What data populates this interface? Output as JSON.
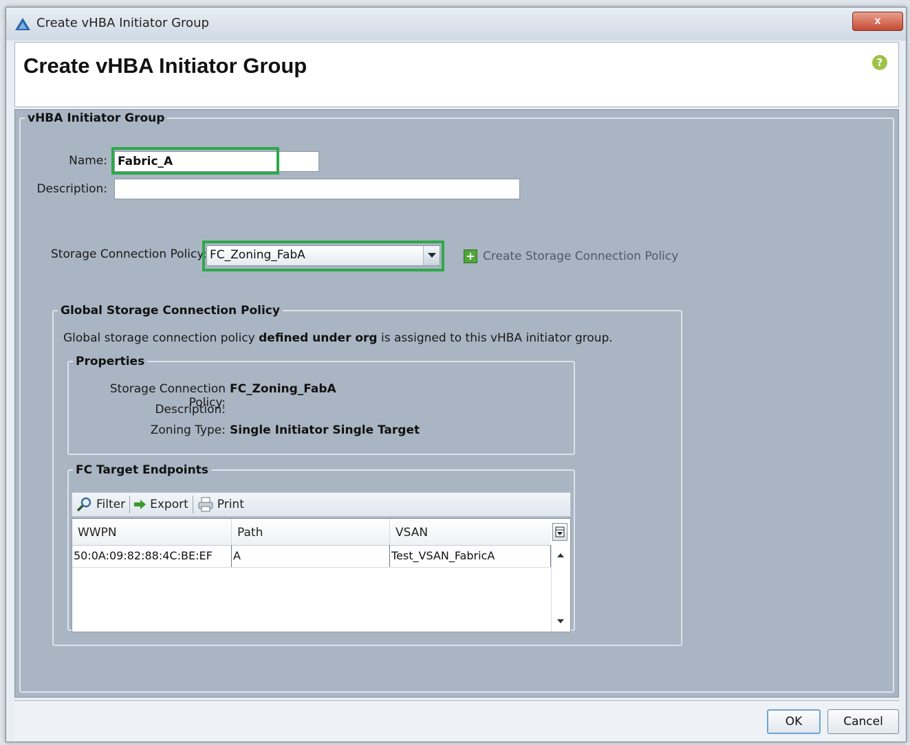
{
  "window": {
    "title": "Create vHBA Initiator Group",
    "close_label": "x"
  },
  "header": {
    "title": "Create vHBA Initiator Group",
    "help_icon": "?"
  },
  "group": {
    "legend": "vHBA Initiator Group",
    "name_label": "Name:",
    "name_value": "Fabric_A",
    "description_label": "Description:",
    "description_value": "",
    "policy_label": "Storage Connection Policy:",
    "policy_value": "FC_Zoning_FabA",
    "create_policy_label": "Create Storage Connection Policy"
  },
  "global_policy": {
    "legend": "Global Storage Connection Policy",
    "desc_prefix": "Global storage connection policy ",
    "desc_bold": "defined under org",
    "desc_suffix": " is assigned to this vHBA initiator group.",
    "properties": {
      "legend": "Properties",
      "policy_label": "Storage Connection Policy:",
      "policy_value": "FC_Zoning_FabA",
      "description_label": "Description:",
      "description_value": "",
      "zoning_label": "Zoning Type:",
      "zoning_value": "Single Initiator Single Target"
    },
    "endpoints": {
      "legend": "FC Target Endpoints",
      "toolbar": {
        "filter": "Filter",
        "export": "Export",
        "print": "Print"
      },
      "columns": [
        "WWPN",
        "Path",
        "VSAN"
      ],
      "rows": [
        {
          "wwpn": "50:0A:09:82:88:4C:BE:EF",
          "path": "A",
          "vsan": "Test_VSAN_FabricA"
        }
      ]
    }
  },
  "footer": {
    "ok": "OK",
    "cancel": "Cancel"
  },
  "colors": {
    "highlight": "#2ea84a",
    "panel": "#a9b5c2",
    "add_icon": "#4fa63b"
  }
}
